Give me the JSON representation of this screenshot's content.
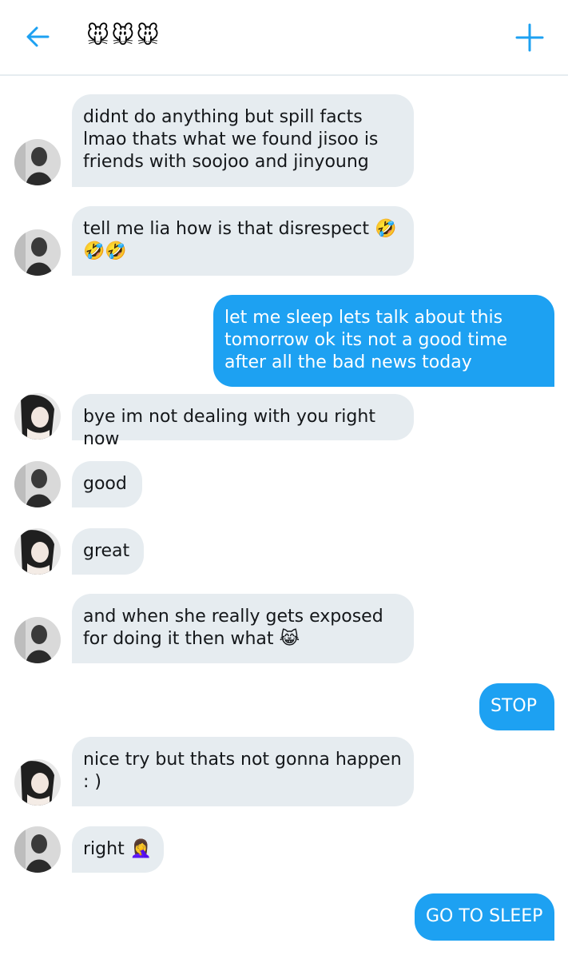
{
  "header": {
    "back_icon": "arrow-left-icon",
    "title": "🐭🐭🐭",
    "new_icon": "plus-icon",
    "accent": "#1da1f2"
  },
  "messages": [
    {
      "sender": "them",
      "text": "didnt do anything but spill facts lmao thats what we found jisoo is friends with soojoo and jinyoung"
    },
    {
      "sender": "them",
      "text": "tell me lia how is that disrespect 🤣🤣🤣"
    },
    {
      "sender": "me",
      "text": "let me sleep lets talk about this tomorrow ok its not a good time after all the bad news today"
    },
    {
      "sender": "them",
      "text": "bye im not dealing with you right now"
    },
    {
      "sender": "them",
      "text": "good"
    },
    {
      "sender": "them",
      "text": "great"
    },
    {
      "sender": "them",
      "text": "and when she really gets exposed for doing it then what 😹"
    },
    {
      "sender": "me",
      "text": "STOP"
    },
    {
      "sender": "them",
      "text": "nice try but thats not gonna happen : )"
    },
    {
      "sender": "them",
      "text": "right 🤦‍♀️"
    },
    {
      "sender": "me",
      "text": "GO TO SLEEP"
    }
  ]
}
